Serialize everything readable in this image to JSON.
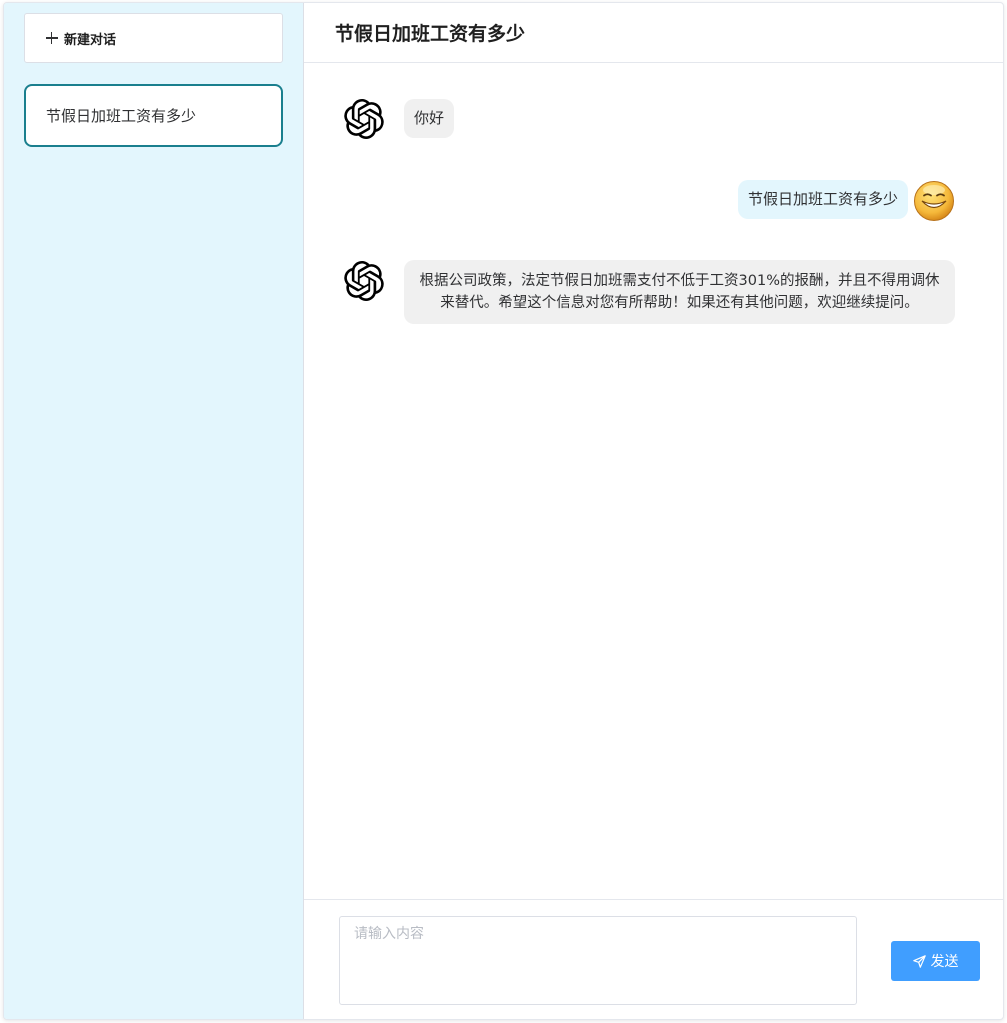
{
  "sidebar": {
    "new_chat_label": "新建对话",
    "conversations": [
      {
        "title": "节假日加班工资有多少"
      }
    ]
  },
  "header": {
    "title": "节假日加班工资有多少"
  },
  "messages": [
    {
      "role": "assistant",
      "text": "你好"
    },
    {
      "role": "user",
      "text": "节假日加班工资有多少"
    },
    {
      "role": "assistant",
      "text": "根据公司政策，法定节假日加班需支付不低于工资301%的报酬，并且不得用调休来替代。希望这个信息对您有所帮助！如果还有其他问题，欢迎继续提问。"
    }
  ],
  "composer": {
    "placeholder": "请输入内容",
    "value": "",
    "send_label": "发送"
  },
  "colors": {
    "sidebar_bg": "#e3f6fd",
    "active_border": "#1a7f8e",
    "bot_bubble": "#f0f0f0",
    "user_bubble": "#e3f6fd",
    "send_button": "#409eff"
  },
  "icons": {
    "bot_avatar": "openai-logo-icon",
    "user_avatar": "smiley-avatar-icon",
    "new_chat": "plus-icon",
    "send": "paper-plane-icon"
  }
}
